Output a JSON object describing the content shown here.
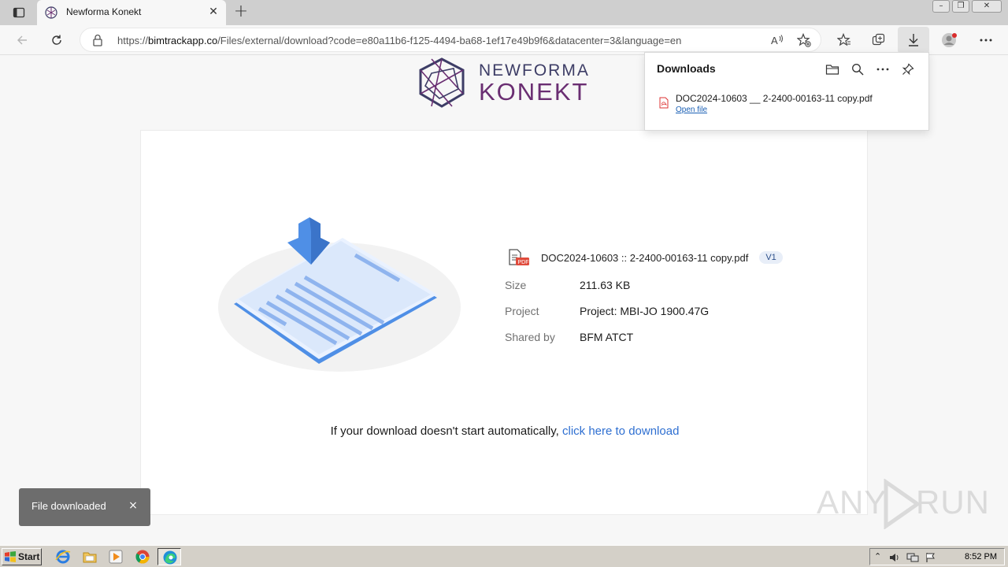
{
  "browser": {
    "tab_title": "Newforma Konekt",
    "url_prefix": "https://",
    "url_host": "bimtrackapp.co",
    "url_path": "/Files/external/download?code=e80a11b6-f125-4494-ba68-1ef17e49b9f6&datacenter=3&language=en"
  },
  "logo": {
    "line1": "NEWFORMA",
    "line2": "KONEKT"
  },
  "file": {
    "name": "DOC2024-10603 :: 2-2400-00163-11 copy.pdf",
    "version": "V1",
    "pdf_tag": "PDF",
    "fields": [
      {
        "label": "Size",
        "value": "211.63 KB"
      },
      {
        "label": "Project",
        "value": "Project: MBI-JO 1900.47G"
      },
      {
        "label": "Shared by",
        "value": "BFM ATCT"
      }
    ]
  },
  "download_message": {
    "text": "If your download doesn't start automatically, ",
    "link_text": "click here",
    "link_suffix": " to download"
  },
  "downloads_flyout": {
    "title": "Downloads",
    "item_name": "DOC2024-10603 __ 2-2400-00163-11 copy.pdf",
    "item_action": "Open file"
  },
  "toast": {
    "text": "File downloaded",
    "close": "×"
  },
  "watermark": {
    "text_left": "ANY",
    "text_right": "RUN"
  },
  "taskbar": {
    "start_label": "Start",
    "clock": "8:52 PM"
  },
  "colors": {
    "accent_link": "#2e6fd1",
    "brand_blue": "#3d3d66",
    "brand_purple": "#6a2e72"
  }
}
